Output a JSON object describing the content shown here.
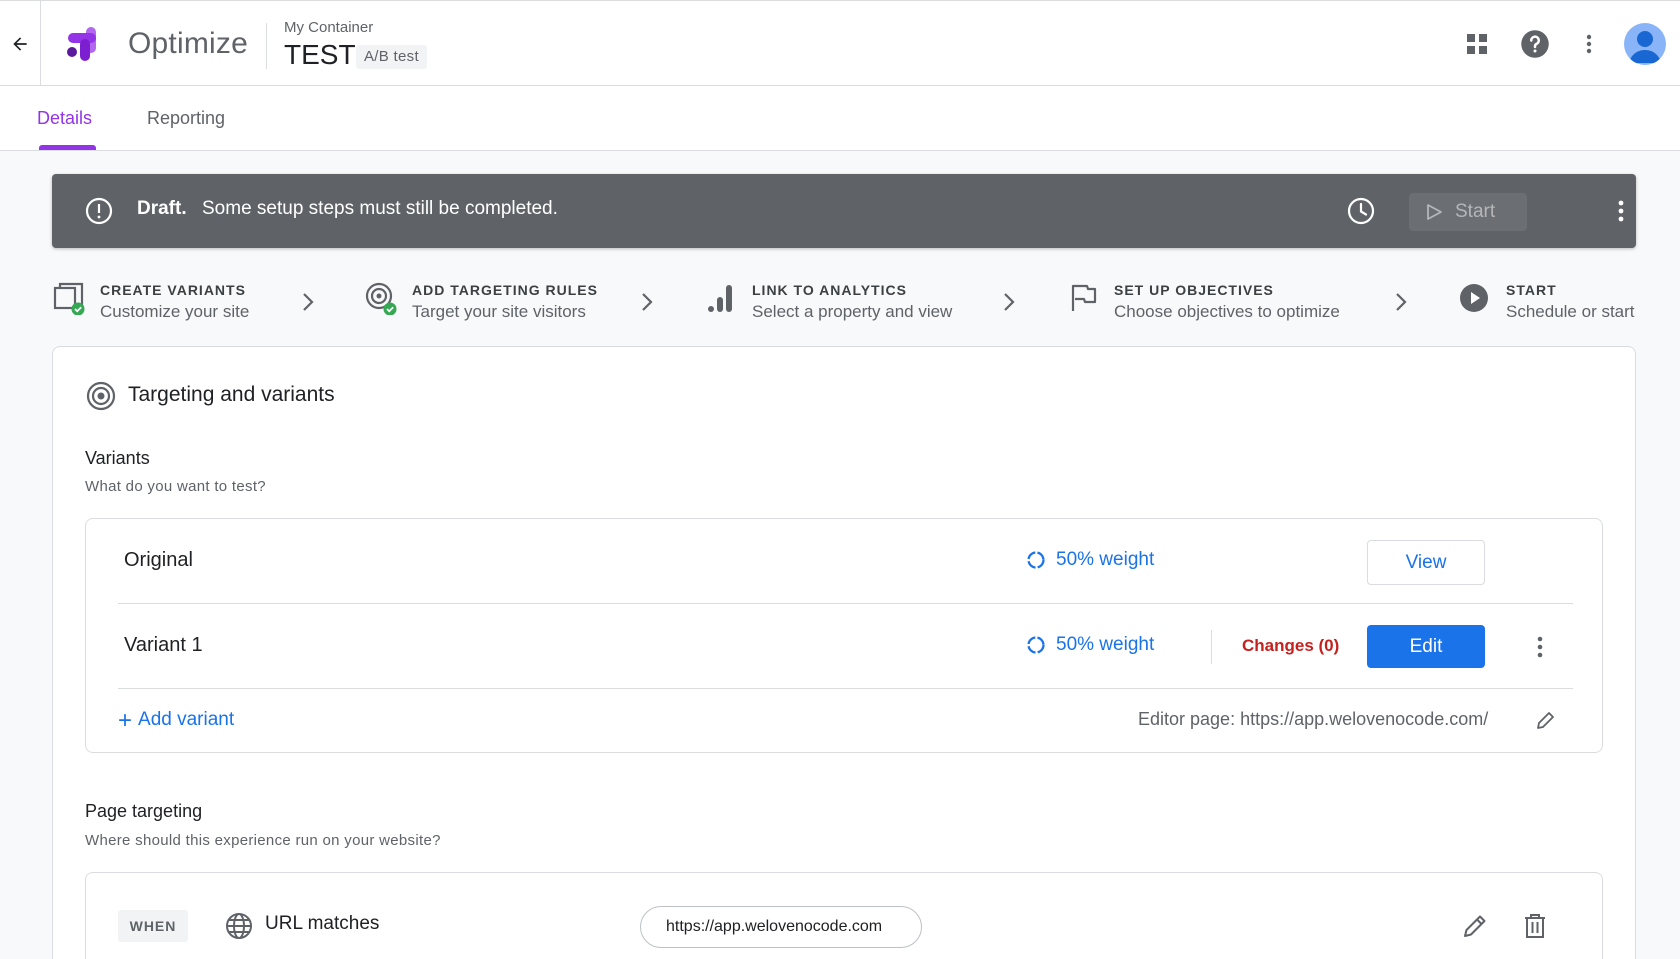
{
  "header": {
    "product_name": "Optimize",
    "container_name": "My Container",
    "experiment_name": "TEST",
    "experiment_type": "A/B test",
    "icons": [
      "back-arrow-icon",
      "apps-grid-icon",
      "help-icon",
      "more-vert-icon",
      "account-avatar"
    ]
  },
  "tabs": [
    {
      "label": "Details",
      "active": true
    },
    {
      "label": "Reporting",
      "active": false
    }
  ],
  "status": {
    "state": "Draft.",
    "message": "Some setup steps must still be completed.",
    "start_label": "Start"
  },
  "steps": [
    {
      "title": "CREATE VARIANTS",
      "subtitle": "Customize your site",
      "icon": "variants-icon",
      "complete": true
    },
    {
      "title": "ADD TARGETING RULES",
      "subtitle": "Target your site visitors",
      "icon": "target-icon",
      "complete": true
    },
    {
      "title": "LINK TO ANALYTICS",
      "subtitle": "Select a property and view",
      "icon": "analytics-icon",
      "complete": false
    },
    {
      "title": "SET UP OBJECTIVES",
      "subtitle": "Choose objectives to optimize",
      "icon": "flag-icon",
      "complete": false
    },
    {
      "title": "START",
      "subtitle": "Schedule or start",
      "icon": "play-circle-icon",
      "complete": false
    }
  ],
  "card": {
    "title": "Targeting and variants",
    "variants": {
      "heading": "Variants",
      "subheading": "What do you want to test?",
      "rows": [
        {
          "name": "Original",
          "weight": "50% weight",
          "action": "View"
        },
        {
          "name": "Variant 1",
          "weight": "50% weight",
          "changes": "Changes (0)",
          "action": "Edit"
        }
      ],
      "add_label": "Add variant",
      "editor_page": "Editor page: https://app.welovenocode.com/"
    },
    "targeting": {
      "heading": "Page targeting",
      "subheading": "Where should this experience run on your website?",
      "when": "WHEN",
      "condition": "URL matches",
      "url": "https://app.welovenocode.com"
    }
  },
  "colors": {
    "accent_purple": "#9334e6",
    "primary_blue": "#1a73e8",
    "banner_gray": "#5f6368",
    "success_green": "#34a853",
    "changes_red": "#c5221f"
  }
}
